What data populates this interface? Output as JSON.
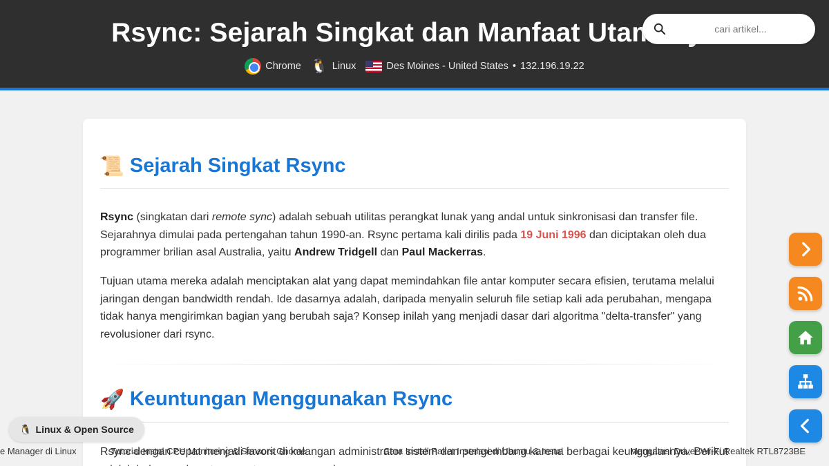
{
  "header": {
    "title": "Rsync: Sejarah Singkat dan Manfaat Utamanya",
    "browser": "Chrome",
    "os": "Linux",
    "location": "Des Moines - United States",
    "separator": "•",
    "ip": "132.196.19.22",
    "accent_color": "#1976d2"
  },
  "search": {
    "placeholder": "cari artikel..."
  },
  "section1": {
    "emoji": "📜",
    "heading": "Sejarah Singkat Rsync",
    "p1": {
      "b1": "Rsync",
      "t1": " (singkatan dari ",
      "i1": "remote sync",
      "t2": ") adalah sebuah utilitas perangkat lunak yang andal untuk sinkronisasi dan transfer file. Sejarahnya dimulai pada pertengahan tahun 1990-an. Rsync pertama kali dirilis pada ",
      "date": "19 Juni 1996",
      "t3": " dan diciptakan oleh dua programmer brilian asal Australia, yaitu ",
      "b2": "Andrew Tridgell",
      "t4": " dan ",
      "b3": "Paul Mackerras",
      "t5": "."
    },
    "p2": "Tujuan utama mereka adalah menciptakan alat yang dapat memindahkan file antar komputer secara efisien, terutama melalui jaringan dengan bandwidth rendah. Ide dasarnya adalah, daripada menyalin seluruh file setiap kali ada perubahan, mengapa tidak hanya mengirimkan bagian yang berubah saja? Konsep inilah yang menjadi dasar dari algoritma \"delta-transfer\" yang revolusioner dari rsync."
  },
  "section2": {
    "emoji": "🚀",
    "heading": "Keuntungan Menggunakan Rsync",
    "p1": "Rsync dengan cepat menjadi favorit di kalangan administrator sistem dan pengembang karena berbagai keunggulannya. Berikut adalah beberapa keuntungan utama menggunakan rsync:"
  },
  "ticker": {
    "items": [
      "e Manager di Linux",
      "Tutorial Instal CPU Monitoring & Sensors Gnome",
      "Cara Install Paket Instalasi di Ubuntu & Instal",
      "Mengatasi Driver Wi-Fi Realtek RTL8723BE"
    ]
  },
  "badge": {
    "emoji": "🐧",
    "label": "Linux & Open Source"
  },
  "fabs": {
    "next_color": "#f5891f",
    "rss_color": "#f5891f",
    "home_color": "#43a047",
    "sitemap_color": "#1e88e5",
    "prev_color": "#1e88e5"
  }
}
